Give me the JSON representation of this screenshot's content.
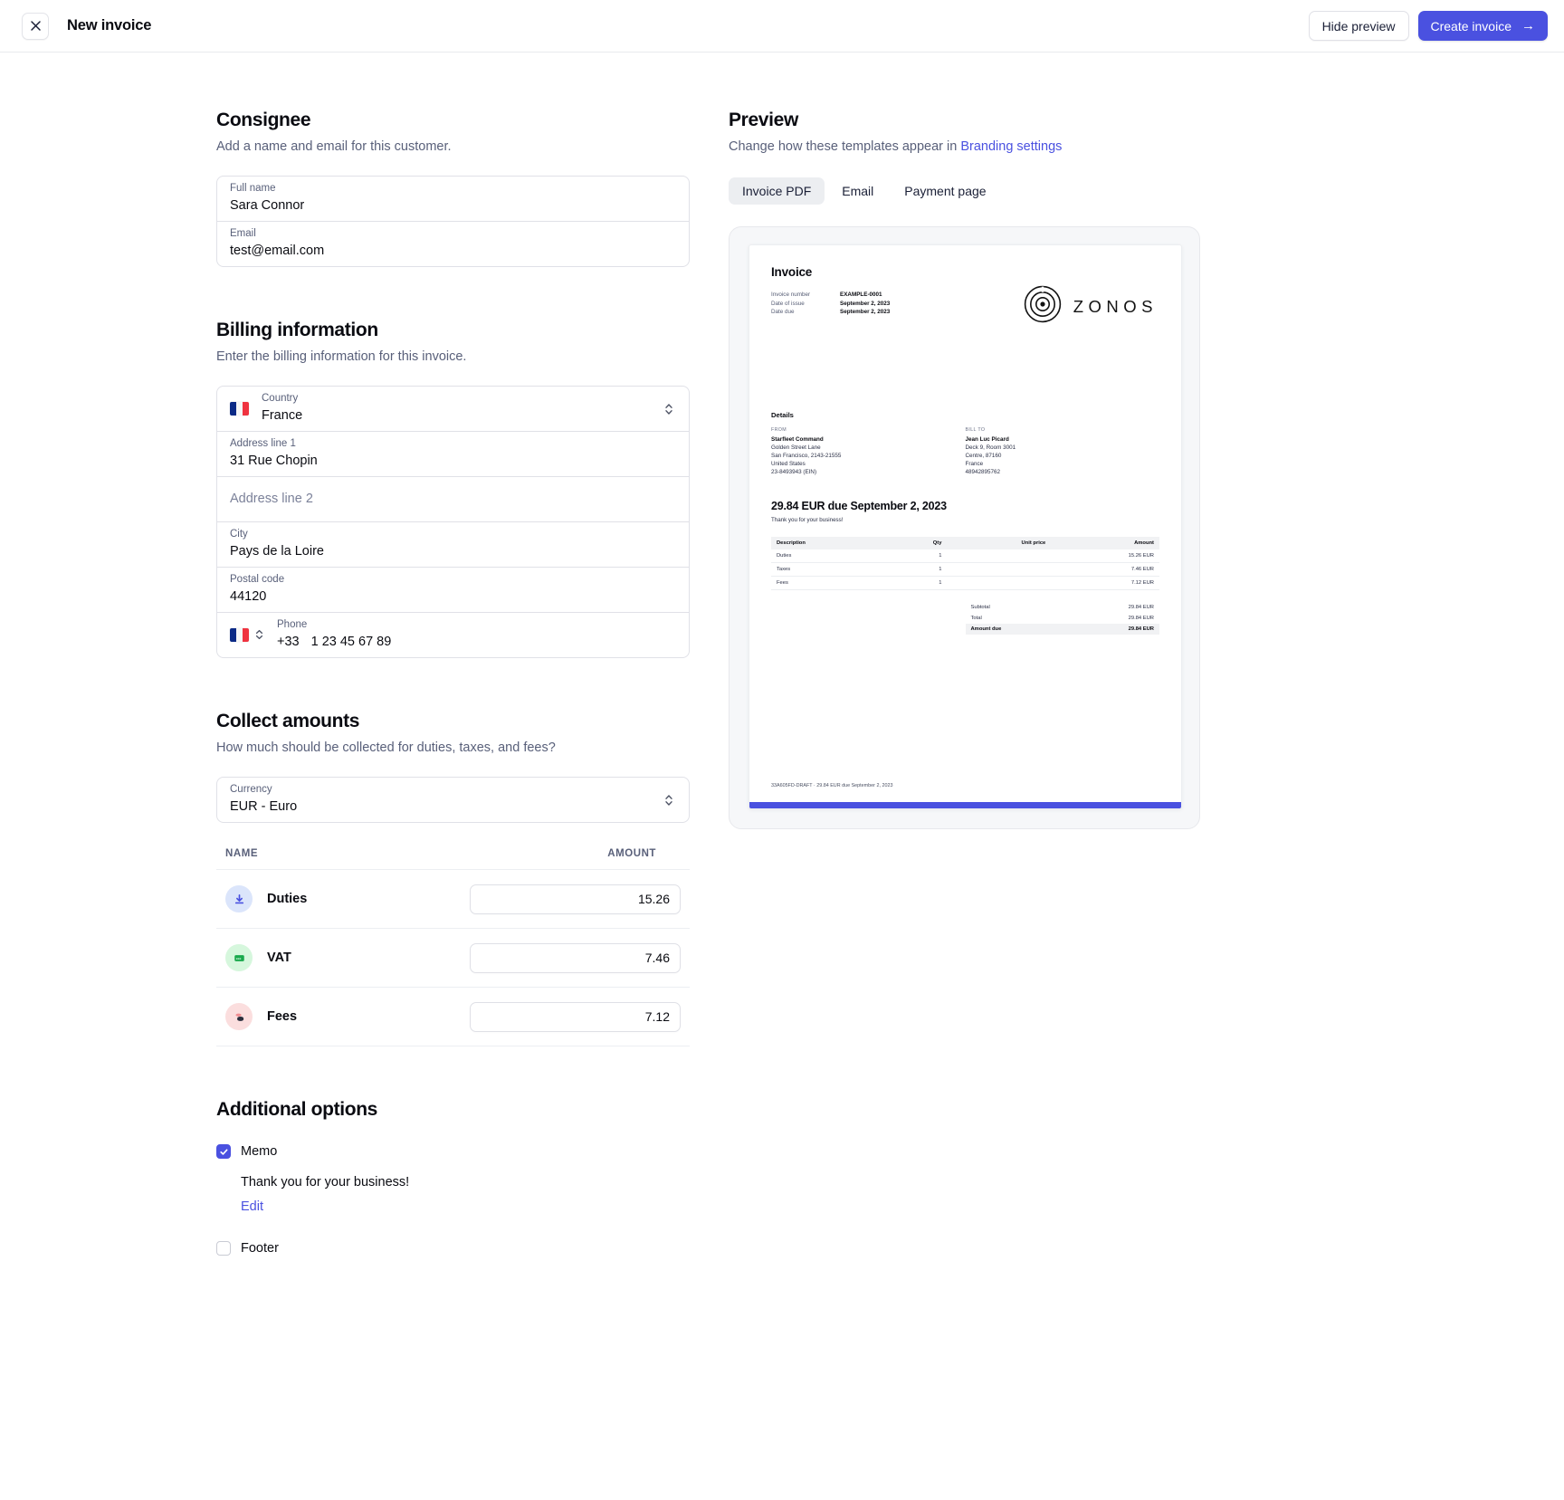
{
  "topbar": {
    "close_icon": "close-icon",
    "title": "New invoice",
    "hide_preview_label": "Hide preview",
    "create_invoice_label": "Create invoice",
    "create_invoice_arrow": "→",
    "primary_color": "#4a51e0"
  },
  "consignee": {
    "title": "Consignee",
    "subtitle": "Add a name and email for this customer.",
    "fields": [
      {
        "label": "Full name",
        "value": "Sara Connor"
      },
      {
        "label": "Email",
        "value": "test@email.com"
      }
    ]
  },
  "billing": {
    "title": "Billing information",
    "subtitle": "Enter the billing information for this invoice.",
    "country": {
      "label": "Country",
      "value": "France",
      "flag": "flag-fr-icon"
    },
    "address1": {
      "label": "Address line 1",
      "value": "31 Rue Chopin"
    },
    "address2": {
      "label": "",
      "placeholder": "Address line 2",
      "value": ""
    },
    "city": {
      "label": "City",
      "value": "Pays de la Loire"
    },
    "postal": {
      "label": "Postal code",
      "value": "44120"
    },
    "phone": {
      "label": "Phone",
      "dial_code": "+33",
      "number": "1 23 45 67 89",
      "flag": "flag-fr-icon"
    }
  },
  "collect": {
    "title": "Collect amounts",
    "subtitle": "How much should be collected for duties, taxes, and fees?",
    "currency": {
      "label": "Currency",
      "value": "EUR - Euro"
    },
    "table": {
      "columns": [
        "NAME",
        "AMOUNT"
      ],
      "rows": [
        {
          "name": "Duties",
          "amount": "15.26",
          "icon": "duties-download-icon",
          "icon_bg": "#dbe5fb",
          "icon_fg": "#4a51e0"
        },
        {
          "name": "VAT",
          "amount": "7.46",
          "icon": "vat-card-icon",
          "icon_bg": "#d6f7dd",
          "icon_fg": "#19a94c"
        },
        {
          "name": "Fees",
          "amount": "7.12",
          "icon": "fees-coins-icon",
          "icon_bg": "#fbdede",
          "icon_fg": "#e0555b"
        }
      ]
    }
  },
  "additional": {
    "title": "Additional options",
    "memo": {
      "label": "Memo",
      "checked": true,
      "text": "Thank you for your business!",
      "edit_label": "Edit"
    },
    "footer": {
      "label": "Footer",
      "checked": false
    }
  },
  "preview": {
    "title": "Preview",
    "subtitle_prefix": "Change how these templates appear in ",
    "subtitle_link": "Branding settings",
    "tabs": [
      {
        "label": "Invoice PDF",
        "active": true
      },
      {
        "label": "Email",
        "active": false
      },
      {
        "label": "Payment page",
        "active": false
      }
    ],
    "document": {
      "title": "Invoice",
      "meta": [
        {
          "key": "Invoice number",
          "value": "EXAMPLE-0001"
        },
        {
          "key": "Date of issue",
          "value": "September 2, 2023"
        },
        {
          "key": "Date due",
          "value": "September 2, 2023"
        }
      ],
      "brand": {
        "wordmark": "ZONOS",
        "logo": "zonos-spiral-logo-icon"
      },
      "details_title": "Details",
      "from": {
        "kicker": "FROM",
        "name": "Starfleet Command",
        "lines": [
          "Golden Street Lane",
          "San Francisco, 2143-21555",
          "United States",
          "23-8493943 (EIN)"
        ]
      },
      "bill_to": {
        "kicker": "BILL TO",
        "name": "Jean Luc Picard",
        "lines": [
          "Deck 9, Room 3001",
          "Centre, 87160",
          "France",
          "48942895762"
        ]
      },
      "due_headline": "29.84 EUR due September 2, 2023",
      "due_note": "Thank you for your business!",
      "table": {
        "columns": [
          "Description",
          "Qty",
          "Unit price",
          "Amount"
        ],
        "rows": [
          {
            "description": "Duties",
            "qty": "1",
            "unit_price": "",
            "amount": "15.26 EUR"
          },
          {
            "description": "Taxes",
            "qty": "1",
            "unit_price": "",
            "amount": "7.46 EUR"
          },
          {
            "description": "Fees",
            "qty": "1",
            "unit_price": "",
            "amount": "7.12 EUR"
          }
        ]
      },
      "totals": [
        {
          "label": "Subtotal",
          "value": "29.84 EUR",
          "strong": false
        },
        {
          "label": "Total",
          "value": "29.84 EUR",
          "strong": false
        },
        {
          "label": "Amount due",
          "value": "29.84 EUR",
          "strong": true
        }
      ],
      "footer_note": "33A605FD-DRAFT · 29.84 EUR due September 2, 2023"
    }
  }
}
